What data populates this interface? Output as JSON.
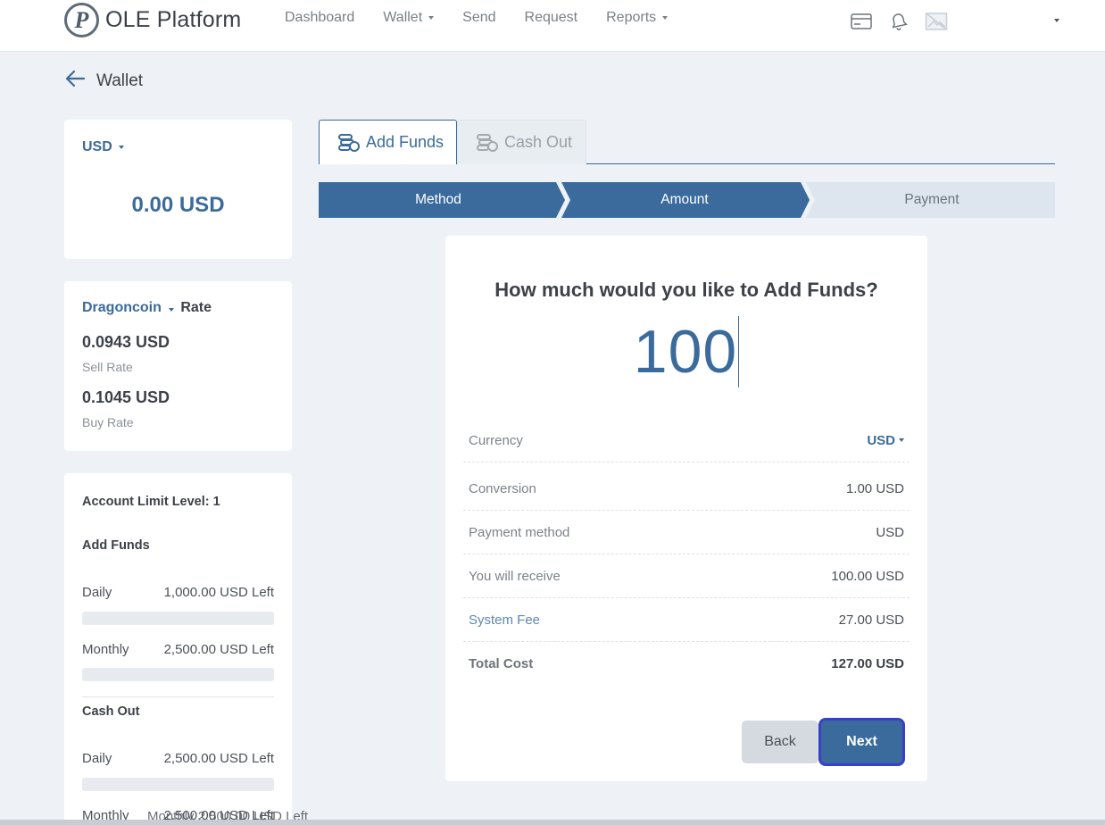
{
  "app": {
    "name": "OLE Platform",
    "logo_letter": "P"
  },
  "nav": {
    "items": [
      {
        "label": "Dashboard",
        "has_menu": false
      },
      {
        "label": "Wallet",
        "has_menu": true
      },
      {
        "label": "Send",
        "has_menu": false
      },
      {
        "label": "Request",
        "has_menu": false
      },
      {
        "label": "Reports",
        "has_menu": true
      }
    ],
    "icons": [
      "card-icon",
      "bell-icon",
      "image-placeholder-icon"
    ]
  },
  "page": {
    "back_icon": "arrow-left-icon",
    "title": "Wallet"
  },
  "balance": {
    "currency": "USD",
    "amount": "0.00 USD"
  },
  "rate": {
    "coin": "Dragoncoin",
    "label": "Rate",
    "sell_value": "0.0943 USD",
    "sell_label": "Sell Rate",
    "buy_value": "0.1045 USD",
    "buy_label": "Buy Rate"
  },
  "limits": {
    "level": "Account Limit Level: 1",
    "add_funds": {
      "title": "Add Funds",
      "daily_label": "Daily",
      "daily_value": "1,000.00 USD Left",
      "daily_used": 0,
      "monthly_label": "Monthly",
      "monthly_value": "2,500.00 USD Left",
      "monthly_used": 0
    },
    "cash_out": {
      "title": "Cash Out",
      "daily_label": "Daily",
      "daily_value": "2,500.00 USD Left",
      "daily_used": 0,
      "monthly_label": "Monthly",
      "monthly_value": "2,500.00 USD Left"
    },
    "overflow_text": "Monthly    2,500.00 USD Left"
  },
  "tabs": [
    {
      "label": "Add Funds",
      "active": true,
      "icon": "coins-icon"
    },
    {
      "label": "Cash Out",
      "active": false,
      "icon": "coins-icon"
    }
  ],
  "steps": [
    {
      "label": "Method",
      "state": "done"
    },
    {
      "label": "Amount",
      "state": "current"
    },
    {
      "label": "Payment",
      "state": "pending"
    }
  ],
  "form": {
    "question": "How much would you like to Add Funds?",
    "amount": "100",
    "rows": [
      {
        "label": "Currency",
        "value": "USD",
        "selectable": true
      },
      {
        "label": "Conversion",
        "value": "1.00 USD"
      },
      {
        "label": "Payment method",
        "value": "USD"
      },
      {
        "label": "You will receive",
        "value": "100.00 USD"
      },
      {
        "label": "System Fee",
        "value": "27.00 USD"
      },
      {
        "label": "Total Cost",
        "value": "127.00 USD"
      }
    ],
    "back_label": "Back",
    "next_label": "Next"
  },
  "colors": {
    "accent": "#3a6b9c",
    "background": "#eef2f6",
    "step_pending": "#dde6ee",
    "focus_ring": "#3a3fc9"
  }
}
